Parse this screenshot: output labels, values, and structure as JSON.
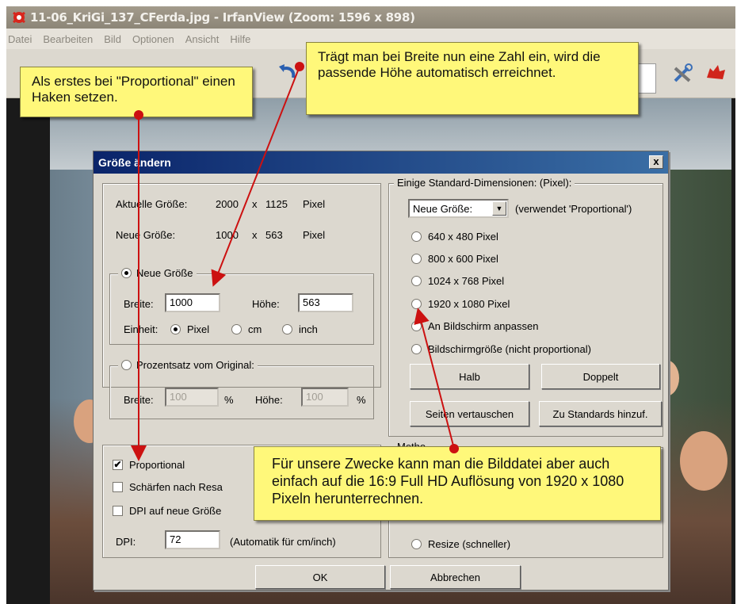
{
  "window": {
    "title": "11-06_KriGi_137_CFerda.jpg - IrfanView (Zoom: 1596 x 898)"
  },
  "menu": [
    "Datei",
    "Bearbeiten",
    "Bild",
    "Optionen",
    "Ansicht",
    "Hilfe"
  ],
  "dialog": {
    "title": "Größe ändern",
    "close": "x",
    "current_size_label": "Aktuelle Größe:",
    "current_width": "2000",
    "current_x": "x",
    "current_height": "1125",
    "current_unit": "Pixel",
    "new_size_label": "Neue Größe:",
    "new_width": "1000",
    "new_x": "x",
    "new_height": "563",
    "new_unit": "Pixel",
    "group_new_size": {
      "legend": "Neue Größe",
      "width_label": "Breite:",
      "width_value": "1000",
      "height_label": "Höhe:",
      "height_value": "563",
      "unit_label": "Einheit:",
      "unit_pixel": "Pixel",
      "unit_cm": "cm",
      "unit_inch": "inch"
    },
    "group_percent": {
      "legend": "Prozentsatz vom Original:",
      "width_label": "Breite:",
      "width_value": "100",
      "pct1": "%",
      "height_label": "Höhe:",
      "height_value": "100",
      "pct2": "%"
    },
    "options": {
      "proportional": "Proportional",
      "sharpen": "Schärfen nach Resa",
      "dpi_adapt": "DPI auf neue Größe",
      "dpi_label": "DPI:",
      "dpi_value": "72",
      "dpi_hint": "(Automatik für cm/inch)"
    },
    "standard": {
      "legend": "Einige Standard-Dimensionen: (Pixel):",
      "select_value": "Neue Größe:",
      "select_hint": "(verwendet 'Proportional')",
      "choices": [
        "640 x 480 Pixel",
        "800 x 600 Pixel",
        "1024 x 768 Pixel",
        "1920 x 1080 Pixel",
        "An Bildschirm anpassen",
        "Bildschirmgröße (nicht proportional)"
      ],
      "halb": "Halb",
      "doppelt": "Doppelt",
      "swap": "Seiten vertauschen",
      "add": "Zu Standards hinzuf."
    },
    "method": {
      "legend": "Metho",
      "resize": "Resize (schneller)"
    },
    "ok": "OK",
    "cancel": "Abbrechen"
  },
  "callouts": {
    "c1": "Als erstes bei \"Proportional\" einen Haken setzen.",
    "c2": "Trägt man bei Breite nun eine Zahl ein, wird die passende Höhe automatisch erreichnet.",
    "c3": "Für unsere Zwecke kann man die Bilddatei aber auch einfach auf die 16:9 Full HD Auflösung von 1920 x 1080 Pixeln herunterrechnen."
  },
  "colors": {
    "callout_bg": "#fff87a",
    "arrow": "#cc1111",
    "dialog_title": "#0a246a"
  }
}
